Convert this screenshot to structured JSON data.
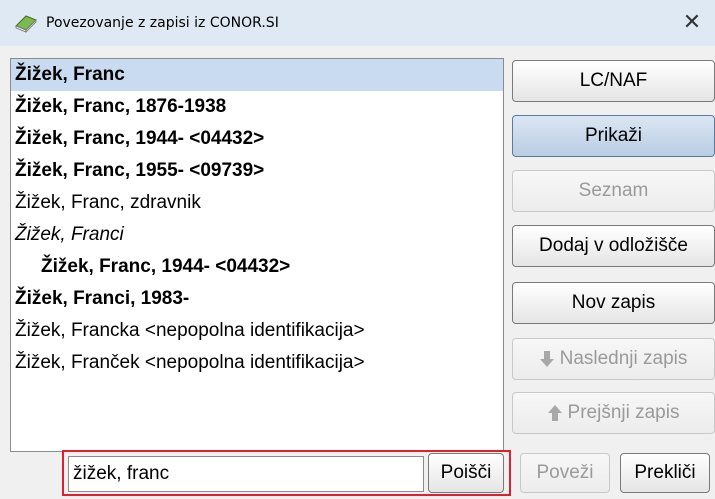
{
  "window": {
    "title": "Povezovanje z zapisi iz CONOR.SI",
    "close_glyph": "✕"
  },
  "list": {
    "items": [
      {
        "text": "Žižek, Franc",
        "bold": true,
        "italic": false,
        "indent": false,
        "selected": true
      },
      {
        "text": "Žižek, Franc, 1876-1938",
        "bold": true,
        "italic": false,
        "indent": false,
        "selected": false
      },
      {
        "text": "Žižek, Franc, 1944- <04432>",
        "bold": true,
        "italic": false,
        "indent": false,
        "selected": false
      },
      {
        "text": "Žižek, Franc, 1955- <09739>",
        "bold": true,
        "italic": false,
        "indent": false,
        "selected": false
      },
      {
        "text": "Žižek, Franc, zdravnik",
        "bold": false,
        "italic": false,
        "indent": false,
        "selected": false
      },
      {
        "text": "Žižek, Franci",
        "bold": false,
        "italic": true,
        "indent": false,
        "selected": false
      },
      {
        "text": "Žižek, Franc, 1944- <04432>",
        "bold": true,
        "italic": false,
        "indent": true,
        "selected": false
      },
      {
        "text": "Žižek, Franci, 1983-",
        "bold": true,
        "italic": false,
        "indent": false,
        "selected": false
      },
      {
        "text": "Žižek, Francka <nepopolna identifikacija>",
        "bold": false,
        "italic": false,
        "indent": false,
        "selected": false
      },
      {
        "text": "Žižek, Franček <nepopolna identifikacija>",
        "bold": false,
        "italic": false,
        "indent": false,
        "selected": false
      }
    ]
  },
  "side_buttons": {
    "lcnaf": "LC/NAF",
    "prikazi": "Prikaži",
    "seznam": "Seznam",
    "dodaj": "Dodaj v odložišče",
    "nov_zapis": "Nov zapis",
    "naslednji": "Naslednji zapis",
    "prejsnji": "Prejšnji zapis"
  },
  "icons": {
    "title": "book-icon",
    "next": "arrow-down-icon",
    "prev": "arrow-up-icon"
  },
  "search": {
    "value": "žižek, franc",
    "button": "Poišči"
  },
  "bottom_buttons": {
    "povezi": "Poveži",
    "preklici": "Prekliči"
  },
  "colors": {
    "selection": "#c8dbf0",
    "highlight_frame": "#e0202a",
    "titlebar": "#dfe9f4"
  }
}
